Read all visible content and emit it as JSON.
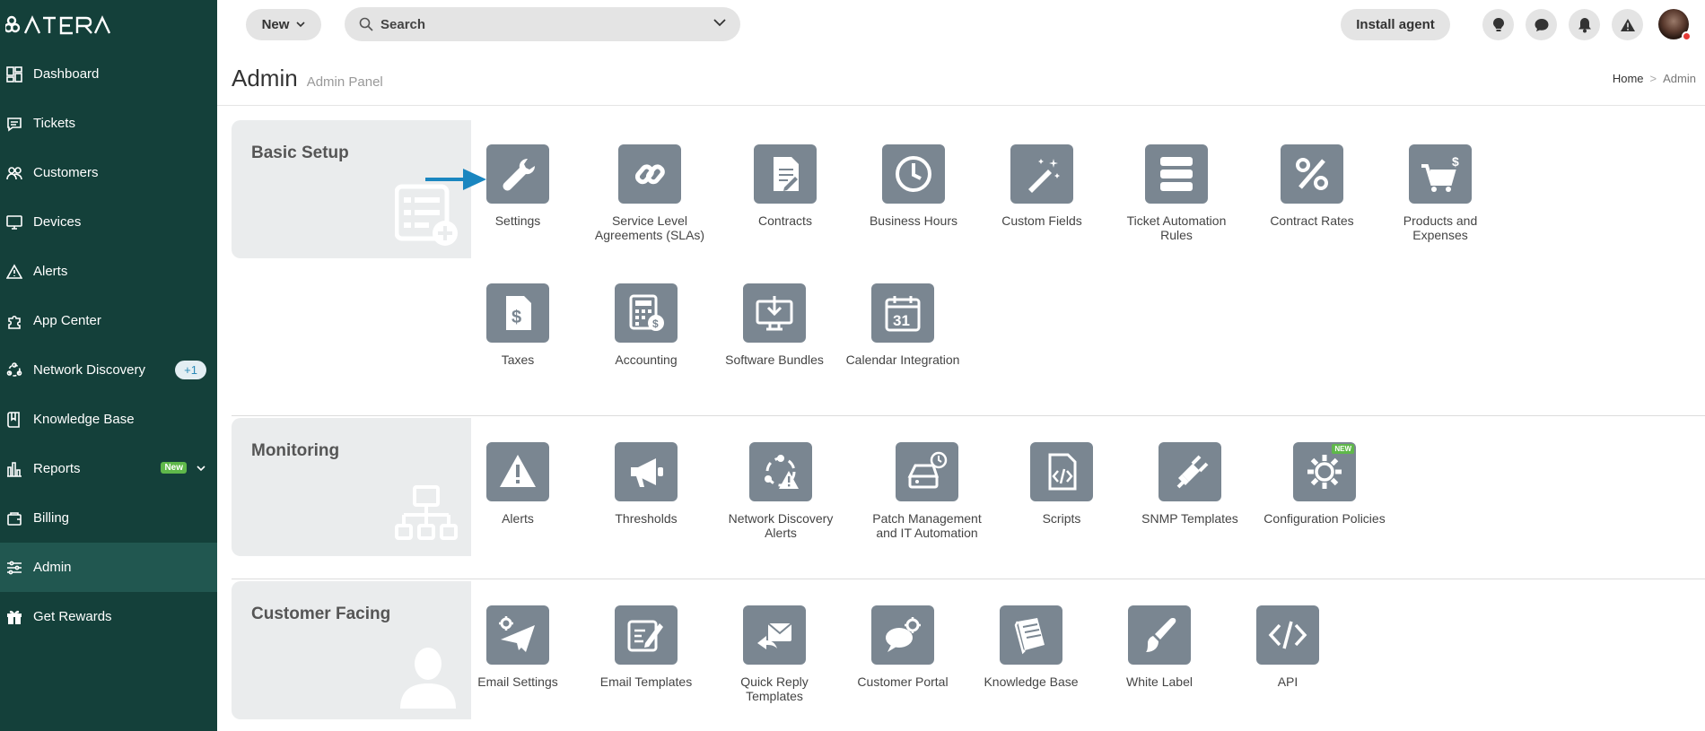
{
  "sidebar": {
    "logo_text": "ATERA",
    "items": [
      {
        "label": "Dashboard",
        "icon": "dashboard-icon"
      },
      {
        "label": "Tickets",
        "icon": "tickets-icon"
      },
      {
        "label": "Customers",
        "icon": "customers-icon"
      },
      {
        "label": "Devices",
        "icon": "devices-icon"
      },
      {
        "label": "Alerts",
        "icon": "alerts-icon"
      },
      {
        "label": "App Center",
        "icon": "app-center-icon"
      },
      {
        "label": "Network Discovery",
        "icon": "network-discovery-icon",
        "badge": "+1"
      },
      {
        "label": "Knowledge Base",
        "icon": "knowledge-base-icon"
      },
      {
        "label": "Reports",
        "icon": "reports-icon",
        "tag": "New"
      },
      {
        "label": "Billing",
        "icon": "billing-icon"
      },
      {
        "label": "Admin",
        "icon": "admin-icon",
        "active": true
      },
      {
        "label": "Get Rewards",
        "icon": "gift-icon"
      }
    ]
  },
  "topbar": {
    "new_label": "New",
    "search_placeholder": "Search",
    "install_label": "Install agent",
    "icons": [
      "lightbulb-icon",
      "chat-icon",
      "bell-icon",
      "warning-icon"
    ]
  },
  "header": {
    "title": "Admin",
    "subtitle": "Admin Panel",
    "breadcrumb": {
      "home": "Home",
      "current": "Admin"
    }
  },
  "sections": {
    "basic": {
      "title": "Basic Setup",
      "tiles": [
        "Settings",
        "Service Level Agreements (SLAs)",
        "Contracts",
        "Business Hours",
        "Custom Fields",
        "Ticket Automation Rules",
        "Contract Rates",
        "Products and Expenses",
        "Taxes",
        "Accounting",
        "Software Bundles",
        "Calendar Integration"
      ]
    },
    "monitoring": {
      "title": "Monitoring",
      "tiles": [
        "Alerts",
        "Thresholds",
        "Network Discovery Alerts",
        "Patch Management and IT Automation",
        "Scripts",
        "SNMP Templates",
        "Configuration Policies"
      ],
      "new_tag": "NEW"
    },
    "customer": {
      "title": "Customer Facing",
      "tiles": [
        "Email Settings",
        "Email Templates",
        "Quick Reply Templates",
        "Customer Portal",
        "Knowledge Base",
        "White Label",
        "API"
      ]
    }
  },
  "colors": {
    "sidebar_bg": "#14403a",
    "sidebar_active": "#215750",
    "tile_icon_bg": "#7a8691",
    "accent_arrow": "#1a86c0",
    "badge_new": "#5fb84a"
  }
}
